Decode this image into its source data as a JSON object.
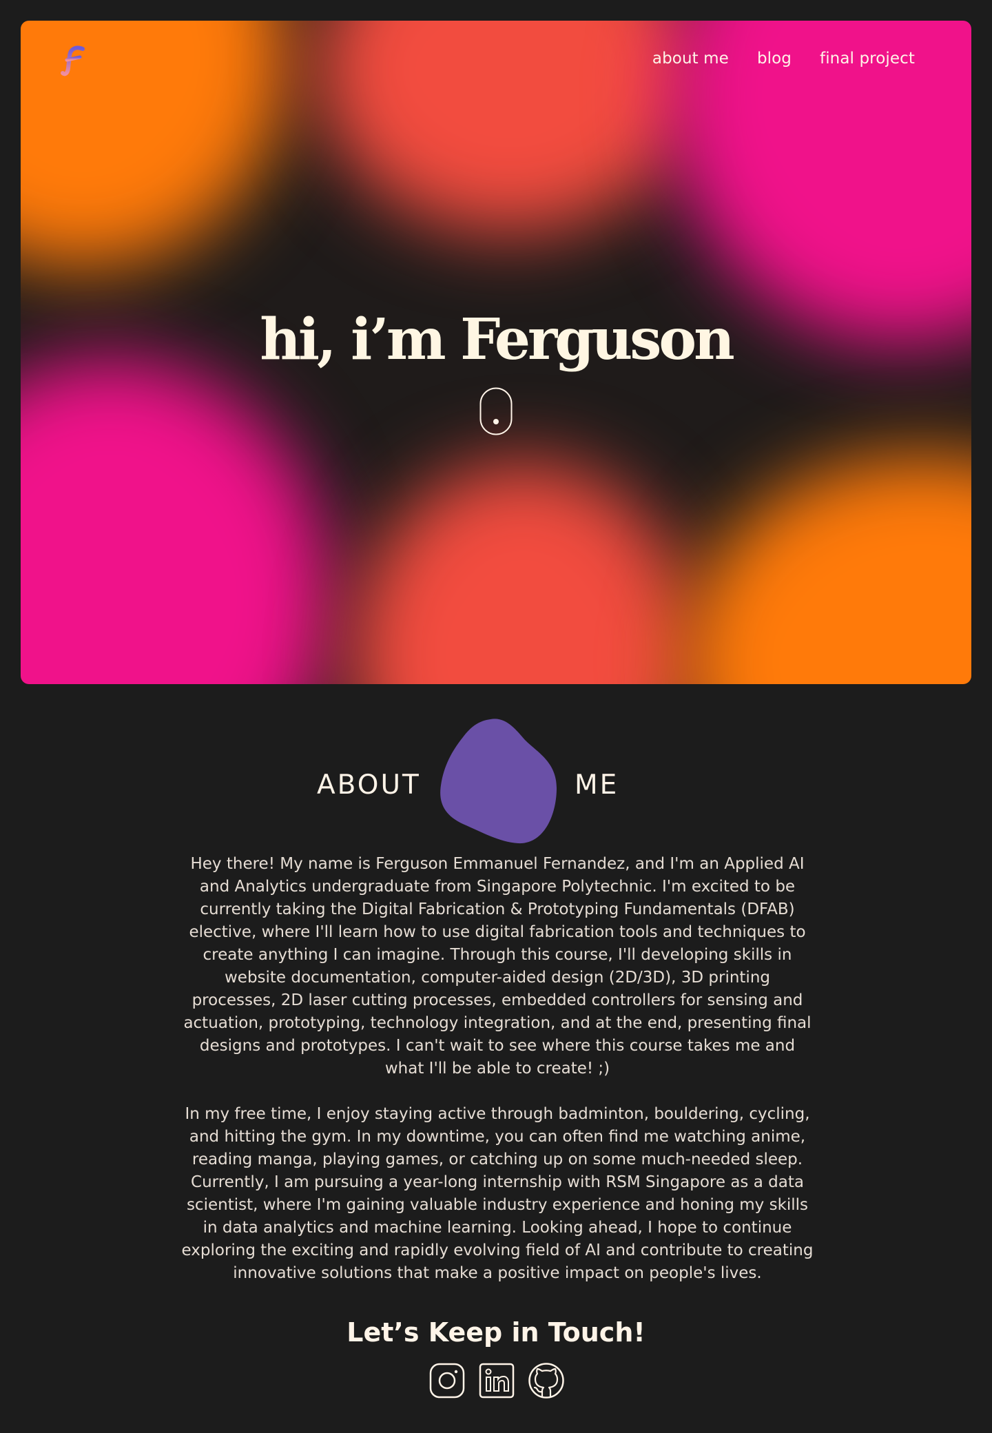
{
  "colors": {
    "background": "#1c1c1c",
    "hero_orange": "#ff7a0a",
    "hero_coral": "#f24c3f",
    "hero_pink": "#f0128a",
    "cream_text": "#fff4e8",
    "about_blob": "#6a50a7"
  },
  "header": {
    "logo_icon": "ferguson-f-logo",
    "nav": [
      {
        "label": "about me"
      },
      {
        "label": "blog"
      },
      {
        "label": "final project"
      }
    ]
  },
  "hero": {
    "title": "hi, i’m Ferguson",
    "scroll_icon": "mouse-scroll-icon"
  },
  "about": {
    "heading_left": "ABOUT",
    "heading_right": "ME",
    "paragraphs": [
      "Hey there! My name is Ferguson Emmanuel Fernandez, and I'm an Applied AI and Analytics undergraduate from Singapore Polytechnic. I'm excited to be currently taking the Digital Fabrication & Prototyping Fundamentals (DFAB) elective, where I'll learn how to use digital fabrication tools and techniques to create anything I can imagine. Through this course, I'll developing skills in website documentation, computer-aided design (2D/3D), 3D printing processes, 2D laser cutting processes, embedded controllers for sensing and actuation, prototyping, technology integration, and at the end, presenting final designs and prototypes. I can't wait to see where this course takes me and what I'll be able to create! ;)",
      "In my free time, I enjoy staying active through badminton, bouldering, cycling, and hitting the gym. In my downtime, you can often find me watching anime, reading manga, playing games, or catching up on some much-needed sleep. Currently, I am pursuing a year-long internship with RSM Singapore as a data scientist, where I'm gaining valuable industry experience and honing my skills in data analytics and machine learning. Looking ahead, I hope to continue exploring the exciting and rapidly evolving field of AI and contribute to creating innovative solutions that make a positive impact on people's lives."
    ]
  },
  "contact": {
    "title": "Let’s Keep in Touch!",
    "icons": [
      "instagram-icon",
      "linkedin-icon",
      "github-icon"
    ]
  }
}
